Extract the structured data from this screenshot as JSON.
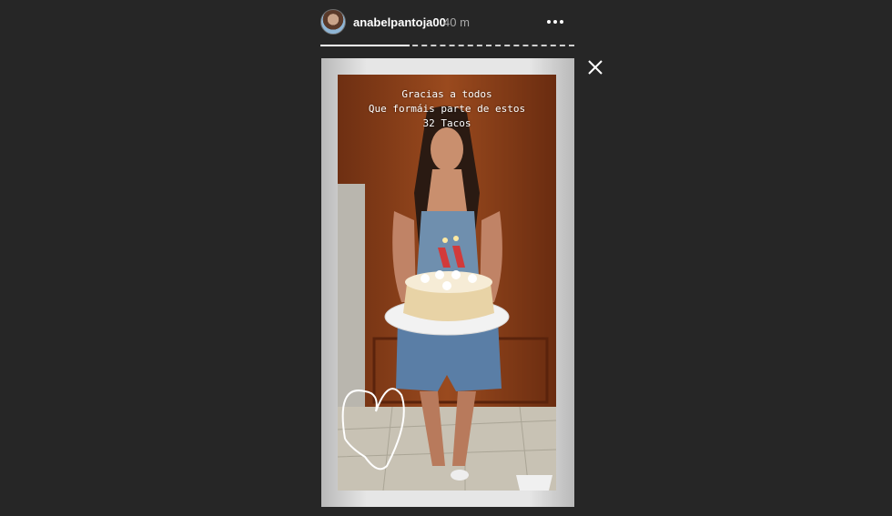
{
  "header": {
    "username": "anabelpantoja00",
    "timestamp": "40 m",
    "avatar_icon": "avatar-icon",
    "more_icon": "more-options-icon"
  },
  "story": {
    "progress": 0.35,
    "caption": "Gracias a todos\nQue formáis parte de estos\n32 Tacos"
  },
  "controls": {
    "close_icon": "close-icon"
  },
  "colors": {
    "background": "#262626",
    "text": "#ffffff",
    "muted": "#a8a8a8"
  }
}
